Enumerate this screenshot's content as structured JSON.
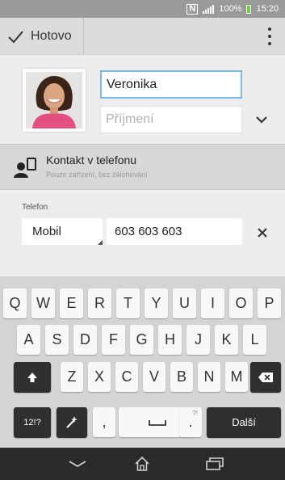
{
  "status_bar": {
    "nfc": "N",
    "battery": "100%",
    "time": "15:20"
  },
  "action_bar": {
    "done_label": "Hotovo"
  },
  "contact": {
    "first_name": "Veronika",
    "last_name_placeholder": "Příjmení"
  },
  "account": {
    "title": "Kontakt v telefonu",
    "subtitle": "Pouze zařízení, bez zálohování"
  },
  "phone": {
    "label": "Telefon",
    "type": "Mobil",
    "number": "603 603 603"
  },
  "keyboard": {
    "row1": [
      "Q",
      "W",
      "E",
      "R",
      "T",
      "Y",
      "U",
      "I",
      "O",
      "P"
    ],
    "row2": [
      "A",
      "S",
      "D",
      "F",
      "G",
      "H",
      "J",
      "K",
      "L"
    ],
    "row3": [
      "Z",
      "X",
      "C",
      "V",
      "B",
      "N",
      "M"
    ],
    "symbols_label": "12!?",
    "comma": ",",
    "period": ".",
    "period_alt": "?!",
    "next_label": "Další"
  },
  "colors": {
    "accent": "#7ab8e6",
    "status_bar": "#9a9a9a",
    "action_bar": "#dcdcdc",
    "keyboard": "#d4d4d4",
    "nav_bar": "#2a2a2a"
  }
}
